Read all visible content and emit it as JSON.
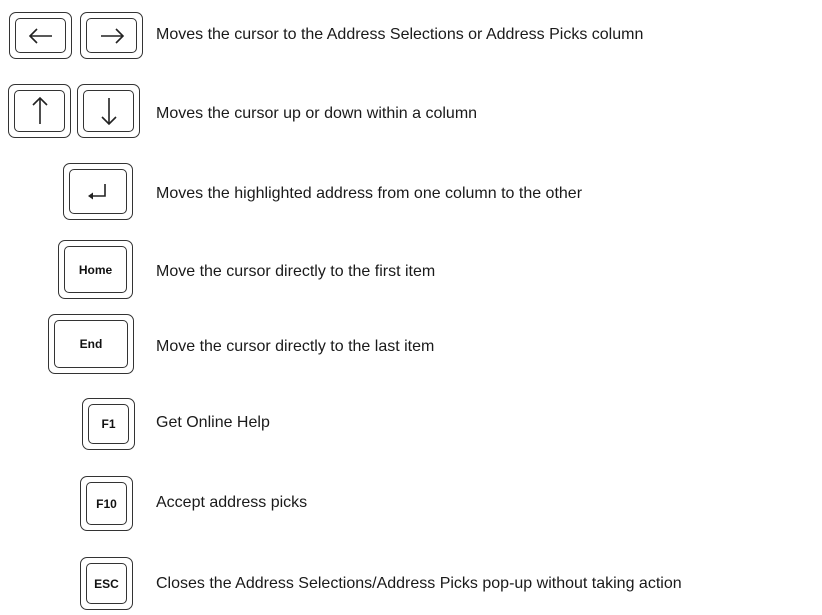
{
  "rows": [
    {
      "keys": [
        "left-arrow",
        "right-arrow"
      ],
      "description": "Moves the cursor to the Address Selections or Address Picks column"
    },
    {
      "keys": [
        "up-arrow",
        "down-arrow"
      ],
      "description": "Moves the cursor up or down within a column"
    },
    {
      "keys": [
        "enter-arrow"
      ],
      "description": "Moves the highlighted address from one column to the other"
    },
    {
      "key_label": "Home",
      "description": "Move the cursor directly to the first item"
    },
    {
      "key_label": "End",
      "description": "Move the cursor directly to the last item"
    },
    {
      "key_label": "F1",
      "description": "Get Online Help"
    },
    {
      "key_label": "F10",
      "description": "Accept address picks"
    },
    {
      "key_label": "ESC",
      "description": "Closes the Address Selections/Address Picks pop-up without taking action"
    }
  ]
}
